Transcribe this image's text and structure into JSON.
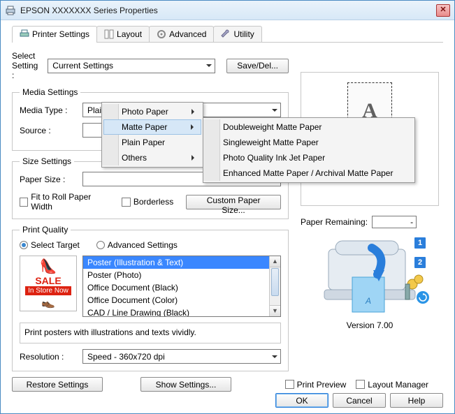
{
  "window_title": "EPSON XXXXXXX Series Properties",
  "tabs": {
    "printer_settings": "Printer Settings",
    "layout": "Layout",
    "advanced": "Advanced",
    "utility": "Utility"
  },
  "select_setting_label": "Select Setting :",
  "select_setting_value": "Current Settings",
  "save_del_btn": "Save/Del...",
  "media": {
    "legend": "Media Settings",
    "type_label": "Media Type :",
    "type_value": "Plain Paper",
    "source_label": "Source :"
  },
  "media_menu": {
    "photo": "Photo Paper",
    "matte": "Matte Paper",
    "plain": "Plain Paper",
    "others": "Others"
  },
  "matte_submenu": {
    "dw": "Doubleweight Matte Paper",
    "sw": "Singleweight Matte Paper",
    "pq": "Photo Quality Ink Jet Paper",
    "enh": "Enhanced Matte Paper / Archival Matte Paper"
  },
  "size": {
    "legend": "Size Settings",
    "paper_size_label": "Paper Size :",
    "fit_roll": "Fit to Roll Paper Width",
    "borderless": "Borderless",
    "custom_btn": "Custom Paper Size..."
  },
  "quality": {
    "legend": "Print Quality",
    "select_target": "Select Target",
    "advanced": "Advanced Settings",
    "targets": [
      "Poster (Illustration & Text)",
      "Poster (Photo)",
      "Office Document (Black)",
      "Office Document (Color)",
      "CAD / Line Drawing (Black)"
    ],
    "description": "Print posters with illustrations and texts vividly.",
    "resolution_label": "Resolution :",
    "resolution_value": "Speed - 360x720 dpi"
  },
  "sale_image": {
    "sale": "SALE",
    "store": "In Store Now"
  },
  "right": {
    "paper_remaining_label": "Paper Remaining:",
    "paper_remaining_value": "-",
    "version": "Version 7.00",
    "badge1": "1",
    "badge2": "2"
  },
  "bottom": {
    "restore": "Restore Settings",
    "show": "Show Settings...",
    "print_preview": "Print Preview",
    "layout_manager": "Layout Manager"
  },
  "dialog": {
    "ok": "OK",
    "cancel": "Cancel",
    "help": "Help"
  }
}
